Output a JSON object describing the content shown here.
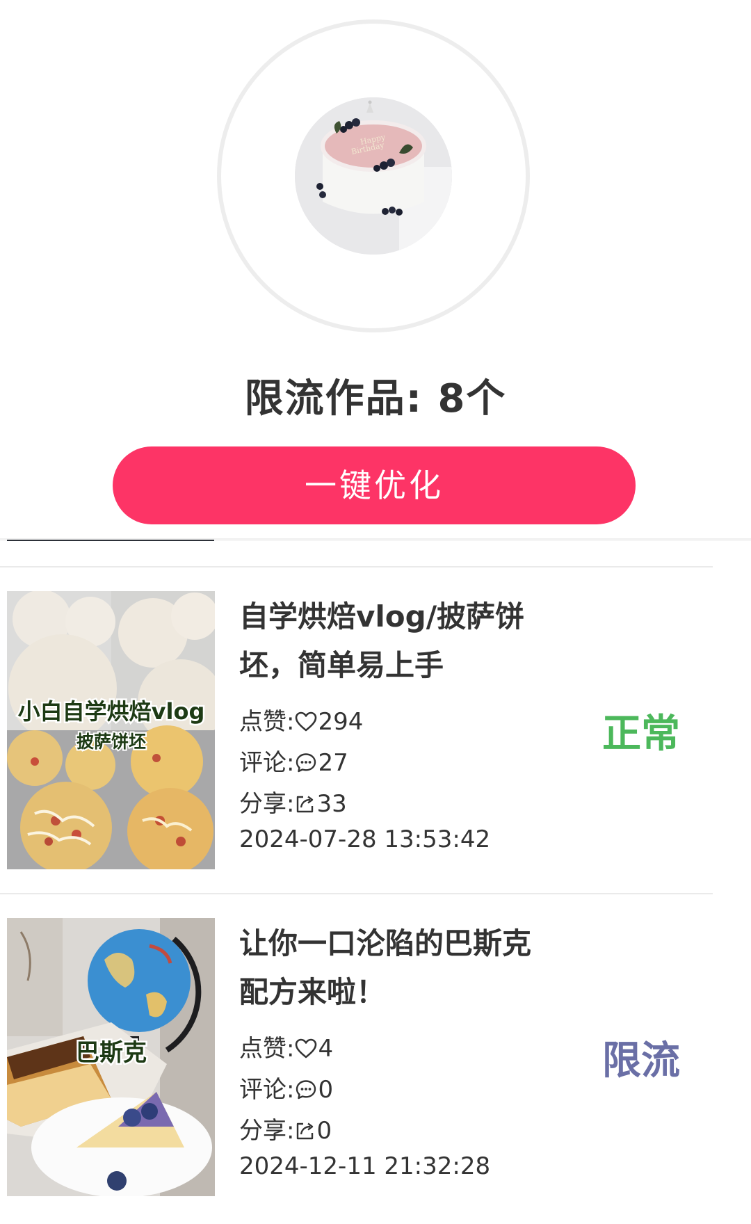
{
  "summary": {
    "title": "限流作品: 8个",
    "optimize_button": "一键优化"
  },
  "posts": [
    {
      "title_line1": "自学烘焙vlog/披萨饼",
      "title_line2": "坯，简单易上手",
      "likes_label": "点赞:",
      "likes": "294",
      "comments_label": "评论:",
      "comments": "27",
      "shares_label": "分享:",
      "shares": "33",
      "date": "2024-07-28 13:53:42",
      "status": "正常",
      "status_color": "#4cb85b",
      "thumb_caption1": "小白自学烘焙vlog",
      "thumb_caption2": "披萨饼坯"
    },
    {
      "title_line1": "让你一口沦陷的巴斯克",
      "title_line2": "配方来啦！",
      "likes_label": "点赞:",
      "likes": "4",
      "comments_label": "评论:",
      "comments": "0",
      "shares_label": "分享:",
      "shares": "0",
      "date": "2024-12-11 21:32:28",
      "status": "限流",
      "status_color": "#6a6fa6",
      "thumb_caption1": "巴斯克"
    }
  ],
  "icons": {
    "like": "heart-icon",
    "comment": "comment-bubble-icon",
    "share": "share-icon"
  }
}
